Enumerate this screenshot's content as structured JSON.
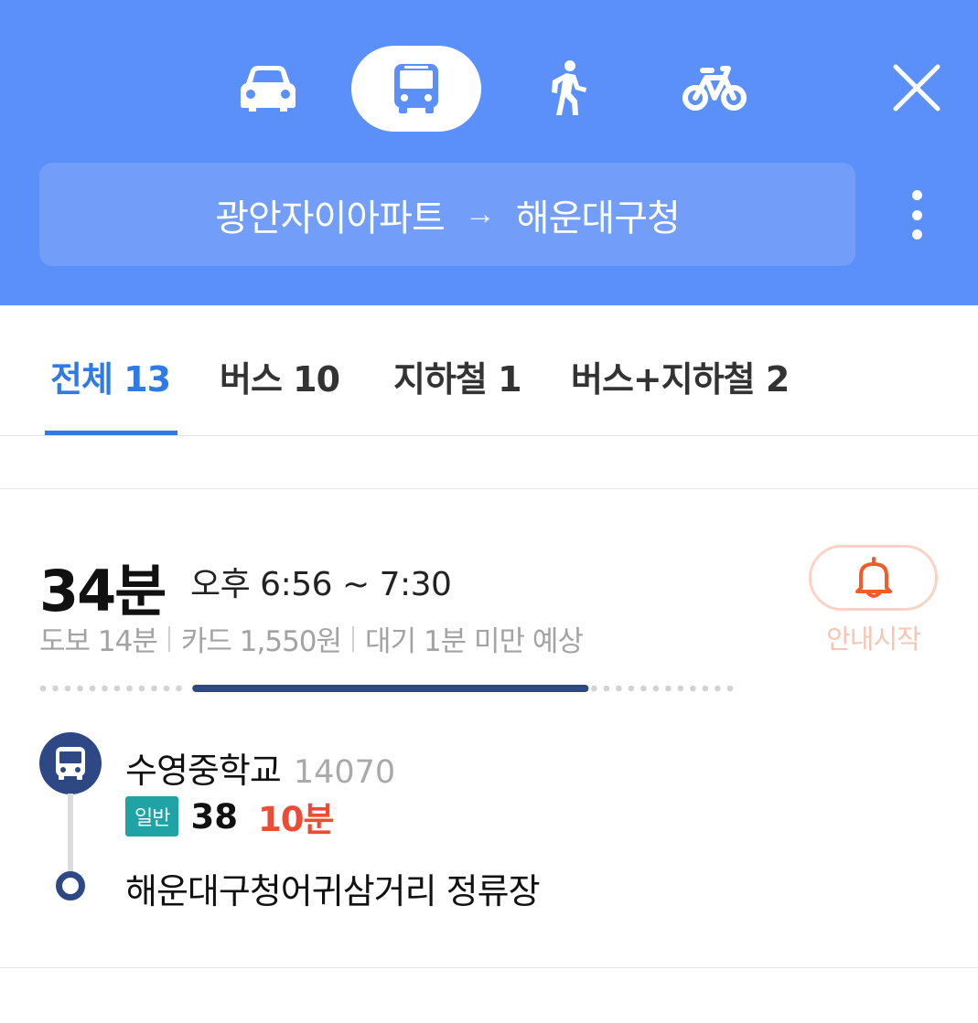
{
  "header": {
    "modes": [
      {
        "name": "car",
        "icon": "car-icon",
        "selected": false
      },
      {
        "name": "bus",
        "icon": "bus-icon",
        "selected": true
      },
      {
        "name": "walk",
        "icon": "walk-icon",
        "selected": false
      },
      {
        "name": "bike",
        "icon": "bike-icon",
        "selected": false
      }
    ],
    "close_icon": "close-icon",
    "origin": "광안자이아파트",
    "arrow": "→",
    "destination": "해운대구청",
    "more_icon": "more-vertical-icon",
    "color": "#5b8ff9"
  },
  "tabs": [
    {
      "label": "전체 13",
      "active": true
    },
    {
      "label": "버스 10",
      "active": false
    },
    {
      "label": "지하철 1",
      "active": false
    },
    {
      "label": "버스+지하철 2",
      "active": false
    }
  ],
  "route": {
    "total_time": "34분",
    "time_range": "오후 6:56 ~ 7:30",
    "meta": [
      "도보 14분",
      "카드 1,550원",
      "대기 1분 미만 예상"
    ],
    "guide_label": "안내시작",
    "guide_icon": "bell-icon",
    "progress": {
      "walk_before": 0.22,
      "bus": 0.57,
      "walk_after": 0.21
    },
    "steps": {
      "boarding_stop": "수영중학교",
      "boarding_stop_id": "14070",
      "bus_type": "일반",
      "bus_number": "38",
      "bus_wait": "10분",
      "alighting_stop": "해운대구청어귀삼거리 정류장"
    }
  },
  "colors": {
    "accent": "#2f7ae5",
    "bus_navy": "#2e4785",
    "bus_badge": "#1fa3a5",
    "wait_red": "#ee4b35",
    "guide_orange": "#f25c2b"
  }
}
